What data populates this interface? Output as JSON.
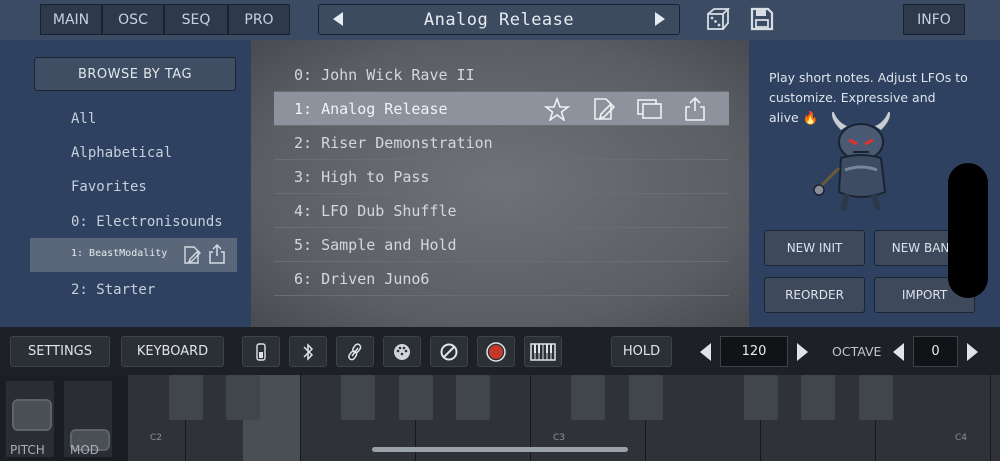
{
  "top_nav": {
    "tabs": [
      "MAIN",
      "OSC",
      "SEQ",
      "PRO"
    ],
    "preset_name": "Analog Release",
    "info_label": "INFO",
    "icons": [
      "dice-icon",
      "save-icon",
      "prev-arrow-icon",
      "next-arrow-icon"
    ]
  },
  "sidebar": {
    "browse_label": "BROWSE BY TAG",
    "items": [
      "All",
      "Alphabetical",
      "Favorites",
      "0: Electronisounds",
      "1: BeastModality",
      "2: Starter"
    ],
    "selected_index": 4
  },
  "preset_list": {
    "items": [
      "0: John Wick Rave II",
      "1: Analog Release",
      "2: Riser Demonstration",
      "3: High to Pass",
      "4: LFO Dub Shuffle",
      "5: Sample and Hold",
      "6: Driven Juno6"
    ],
    "selected_index": 1,
    "row_actions": [
      "star-icon",
      "edit-icon",
      "duplicate-icon",
      "share-icon"
    ]
  },
  "info_panel": {
    "description": "Play short notes. Adjust LFOs to customize. Expressive and alive 🔥",
    "buttons": [
      "NEW INIT",
      "NEW BANK",
      "REORDER",
      "IMPORT"
    ]
  },
  "controls": {
    "settings_label": "SETTINGS",
    "keyboard_label": "KEYBOARD",
    "hold_label": "HOLD",
    "tempo": "120",
    "octave_label": "OCTAVE",
    "octave_value": "0",
    "record_color": "#c0392b"
  },
  "keyboard": {
    "octave_labels": [
      "C2",
      "C3",
      "C4"
    ],
    "pitch_label": "PITCH",
    "mod_label": "MOD"
  }
}
